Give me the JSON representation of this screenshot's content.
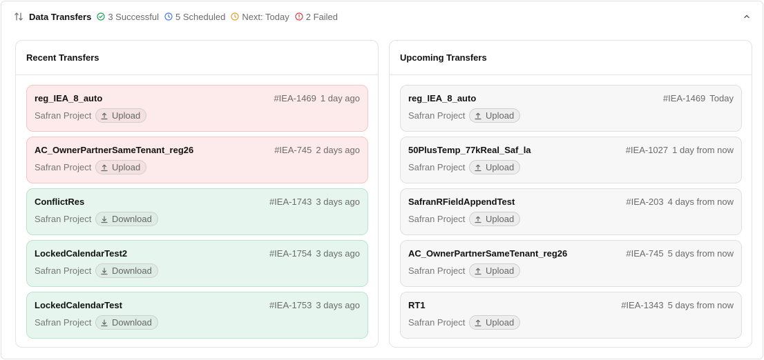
{
  "header": {
    "title": "Data Transfers",
    "stats": {
      "successful": "3 Successful",
      "scheduled": "5 Scheduled",
      "next": "Next: Today",
      "failed": "2 Failed"
    },
    "colors": {
      "successful": "#22a05b",
      "scheduled": "#4a7fd6",
      "next": "#e0a03a",
      "failed": "#d64545"
    }
  },
  "recent": {
    "title": "Recent Transfers",
    "items": [
      {
        "name": "reg_IEA_8_auto",
        "id": "#IEA-1469",
        "time": "1 day ago",
        "project": "Safran Project",
        "type": "Upload",
        "status": "failed"
      },
      {
        "name": "AC_OwnerPartnerSameTenant_reg26",
        "id": "#IEA-745",
        "time": "2 days ago",
        "project": "Safran Project",
        "type": "Upload",
        "status": "failed"
      },
      {
        "name": "ConflictRes",
        "id": "#IEA-1743",
        "time": "3 days ago",
        "project": "Safran Project",
        "type": "Download",
        "status": "success"
      },
      {
        "name": "LockedCalendarTest2",
        "id": "#IEA-1754",
        "time": "3 days ago",
        "project": "Safran Project",
        "type": "Download",
        "status": "success"
      },
      {
        "name": "LockedCalendarTest",
        "id": "#IEA-1753",
        "time": "3 days ago",
        "project": "Safran Project",
        "type": "Download",
        "status": "success"
      }
    ]
  },
  "upcoming": {
    "title": "Upcoming Transfers",
    "items": [
      {
        "name": "reg_IEA_8_auto",
        "id": "#IEA-1469",
        "time": "Today",
        "project": "Safran Project",
        "type": "Upload"
      },
      {
        "name": "50PlusTemp_77kReal_Saf_la",
        "id": "#IEA-1027",
        "time": "1 day from now",
        "project": "Safran Project",
        "type": "Upload"
      },
      {
        "name": "SafranRFieldAppendTest",
        "id": "#IEA-203",
        "time": "4 days from now",
        "project": "Safran Project",
        "type": "Upload"
      },
      {
        "name": "AC_OwnerPartnerSameTenant_reg26",
        "id": "#IEA-745",
        "time": "5 days from now",
        "project": "Safran Project",
        "type": "Upload"
      },
      {
        "name": "RT1",
        "id": "#IEA-1343",
        "time": "5 days from now",
        "project": "Safran Project",
        "type": "Upload"
      }
    ]
  }
}
